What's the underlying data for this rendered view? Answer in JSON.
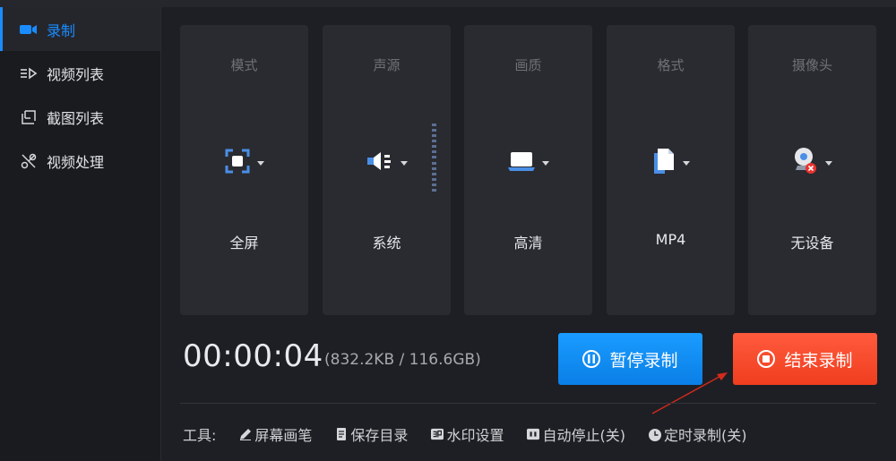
{
  "sidebar": {
    "items": [
      {
        "label": "录制",
        "icon": "camera-icon",
        "active": true
      },
      {
        "label": "视频列表",
        "icon": "video-list-icon"
      },
      {
        "label": "截图列表",
        "icon": "screenshot-list-icon"
      },
      {
        "label": "视频处理",
        "icon": "video-tools-icon"
      }
    ]
  },
  "cards": [
    {
      "title": "模式",
      "value": "全屏",
      "icon": "fullscreen-icon"
    },
    {
      "title": "声源",
      "value": "系统",
      "icon": "speaker-icon"
    },
    {
      "title": "画质",
      "value": "高清",
      "icon": "monitor-icon"
    },
    {
      "title": "格式",
      "value": "MP4",
      "icon": "file-icon"
    },
    {
      "title": "摄像头",
      "value": "无设备",
      "icon": "webcam-disabled-icon"
    }
  ],
  "status": {
    "timer": "00:00:04",
    "size": "(832.2KB / 116.6GB)"
  },
  "buttons": {
    "pause": "暂停录制",
    "stop": "结束录制"
  },
  "tools": {
    "label": "工具:",
    "items": [
      {
        "label": "屏幕画笔",
        "icon": "pen-icon"
      },
      {
        "label": "保存目录",
        "icon": "folder-doc-icon"
      },
      {
        "label": "水印设置",
        "icon": "watermark-icon"
      },
      {
        "label": "自动停止(关)",
        "icon": "auto-stop-icon"
      },
      {
        "label": "定时录制(关)",
        "icon": "clock-icon"
      }
    ]
  },
  "colors": {
    "accent": "#1a8cff",
    "stop": "#f0421f",
    "background": "#1e1f24",
    "card": "#2a2b31"
  }
}
